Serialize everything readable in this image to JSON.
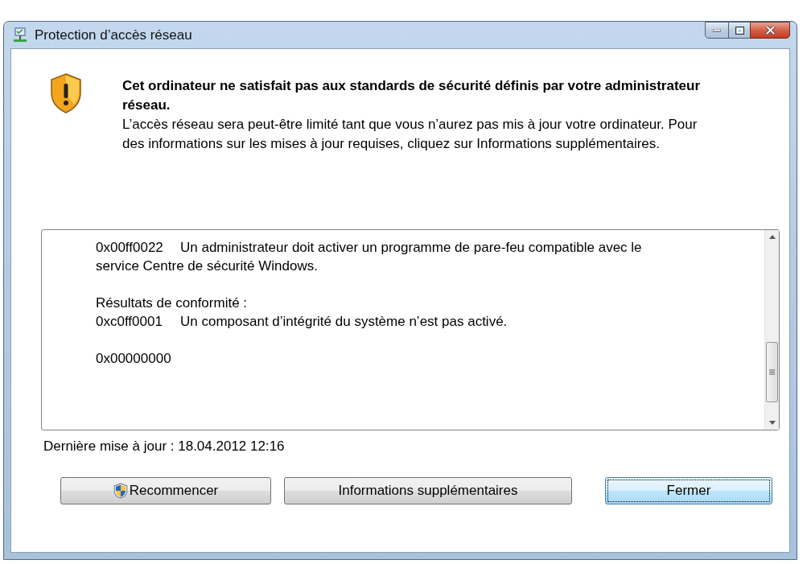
{
  "window": {
    "title": "Protection d’accès réseau"
  },
  "heading": "Cet ordinateur ne satisfait pas aux standards de sécurité définis par votre administrateur réseau.",
  "message": "L’accès réseau sera peut-être limité tant que vous n’aurez pas mis à jour votre ordinateur. Pour des informations sur les mises à jour requises, cliquez sur Informations supplémentaires.",
  "details": [
    {
      "kind": "entry",
      "code": "0x00ff0022",
      "text": "Un administrateur doit activer un programme de pare-feu compatible avec le service Centre de sécurité Windows."
    },
    {
      "kind": "heading",
      "text": "Résultats de conformité :"
    },
    {
      "kind": "entry",
      "code": "0xc0ff0001",
      "text": "Un composant d’intégrité du système n’est pas activé."
    },
    {
      "kind": "code",
      "code": "0x00000000"
    }
  ],
  "last_update": "Dernière mise à jour : 18.04.2012 12:16",
  "buttons": [
    {
      "label": "Recommencer",
      "shield": true,
      "focused": false
    },
    {
      "label": "Informations supplémentaires",
      "shield": false,
      "focused": false
    },
    {
      "label": "Fermer",
      "shield": false,
      "focused": true
    }
  ]
}
